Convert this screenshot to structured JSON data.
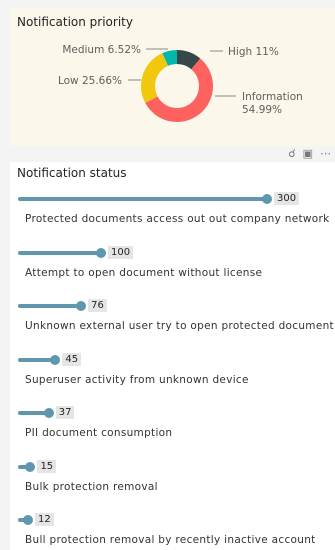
{
  "toolbar": {
    "pin_icon": "pin-icon",
    "focus_icon": "focus-mode-icon",
    "more_icon": "more-options-icon"
  },
  "charts": {
    "priority": {
      "title": "Notification priority"
    },
    "status": {
      "title": "Notification status"
    }
  },
  "chart_data": [
    {
      "type": "pie",
      "title": "Notification priority",
      "donut": true,
      "slices": [
        {
          "label": "High",
          "value": 11,
          "display": "High 11%",
          "color": "#374649"
        },
        {
          "label": "Information",
          "value": 54.99,
          "display": "Information\n54.99%",
          "color": "#fd625e"
        },
        {
          "label": "Low",
          "value": 25.66,
          "display": "Low 25.66%",
          "color": "#f2c80f"
        },
        {
          "label": "Medium",
          "value": 6.52,
          "display": "Medium 6.52%",
          "color": "#01b8aa"
        }
      ]
    },
    {
      "type": "bar",
      "orientation": "horizontal",
      "style": "lollipop",
      "title": "Notification status",
      "bar_color": "#5f98ae",
      "categories": [
        "Protected documents access out out company network",
        "Attempt to open document without license",
        "Unknown external user try to open protected document",
        "Superuser activity from unknown device",
        "PII document consumption",
        "Bulk protection removal",
        "Bull protection removal by recently inactive account"
      ],
      "values": [
        300,
        100,
        76,
        45,
        37,
        15,
        12
      ]
    }
  ]
}
